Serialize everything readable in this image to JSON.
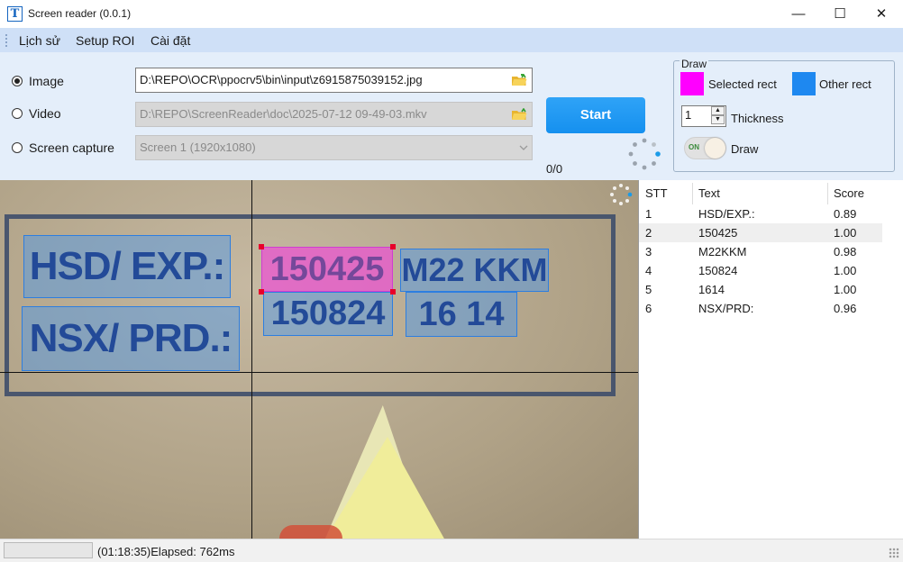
{
  "window": {
    "title": "Screen reader (0.0.1)",
    "app_icon_glyph": "T",
    "minimize_glyph": "—",
    "maximize_glyph": "☐",
    "close_glyph": "✕"
  },
  "menu": {
    "items": [
      "Lịch sử",
      "Setup ROI",
      "Cài đặt"
    ]
  },
  "source": {
    "image_label": "Image",
    "video_label": "Video",
    "screen_label": "Screen capture",
    "selected": "Image",
    "image_path": "D:\\REPO\\OCR\\ppocrv5\\bin\\input\\z6915875039152.jpg",
    "video_path": "D:\\REPO\\ScreenReader\\doc\\2025-07-12 09-49-03.mkv",
    "screen_value": "Screen 1 (1920x1080)"
  },
  "actions": {
    "start_label": "Start",
    "progress": "0/0"
  },
  "draw": {
    "group_title": "Draw",
    "selected_rect_label": "Selected rect",
    "selected_rect_color": "#ff00ff",
    "other_rect_label": "Other rect",
    "other_rect_color": "#1e88f0",
    "thickness_value": "1",
    "thickness_label": "Thickness",
    "toggle_on_text": "ON",
    "toggle_label": "Draw",
    "toggle_state": true
  },
  "results": {
    "columns": [
      "STT",
      "Text",
      "Score"
    ],
    "rows": [
      {
        "stt": "1",
        "text": "HSD/EXP.:",
        "score": "0.89"
      },
      {
        "stt": "2",
        "text": "150425",
        "score": "1.00"
      },
      {
        "stt": "3",
        "text": "M22KKM",
        "score": "0.98"
      },
      {
        "stt": "4",
        "text": "150824",
        "score": "1.00"
      },
      {
        "stt": "5",
        "text": "1614",
        "score": "1.00"
      },
      {
        "stt": "6",
        "text": "NSX/PRD:",
        "score": "0.96"
      }
    ]
  },
  "ocr_image": {
    "labels": [
      "HSD/ EXP.:",
      "150425",
      "M22 KKM",
      "150824",
      "16 14",
      "NSX/ PRD.:"
    ],
    "selected_index": 1
  },
  "status": {
    "text": "(01:18:35)Elapsed: 762ms"
  }
}
